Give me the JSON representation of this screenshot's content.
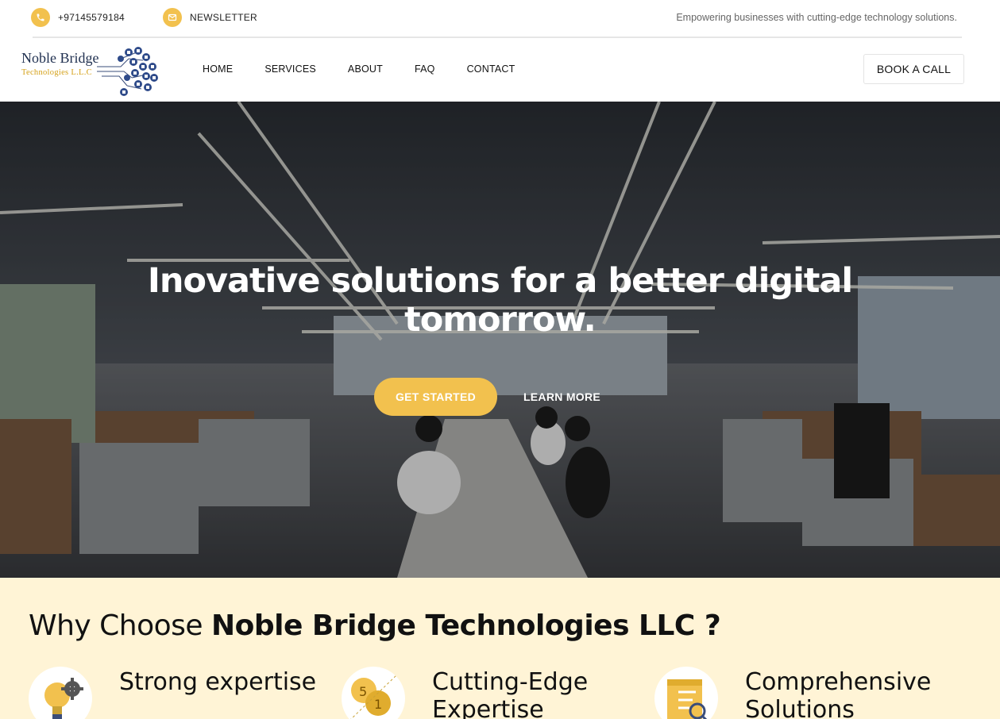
{
  "topbar": {
    "phone": "+97145579184",
    "newsletter": "NEWSLETTER",
    "tagline": "Empowering businesses with cutting-edge technology solutions.",
    "phone_icon": "phone-icon",
    "mail_icon": "mail-icon"
  },
  "logo": {
    "name": "Noble Bridge",
    "sub": "Technologies L.L.C"
  },
  "nav": {
    "items": [
      "HOME",
      "SERVICES",
      "ABOUT",
      "FAQ",
      "CONTACT"
    ]
  },
  "header": {
    "book_label": "BOOK A CALL"
  },
  "hero": {
    "title_line1": "Inovative solutions for a better digital",
    "title_line2": "tomorrow.",
    "start_label": "GET STARTED",
    "more_label": "LEARN MORE"
  },
  "why": {
    "title_prefix": "Why Choose ",
    "title_bold": "Noble Bridge Technologies LLC ?",
    "features": [
      {
        "title": "Strong expertise",
        "icon": "lightbulb-gear-icon"
      },
      {
        "title": "Cutting-Edge Expertise",
        "icon": "coins-icon"
      },
      {
        "title": "Comprehensive Solutions",
        "icon": "document-search-icon"
      }
    ]
  },
  "colors": {
    "accent": "#f2c14e",
    "section_bg": "#fff4d6",
    "logo_navy": "#1f2f4f"
  }
}
